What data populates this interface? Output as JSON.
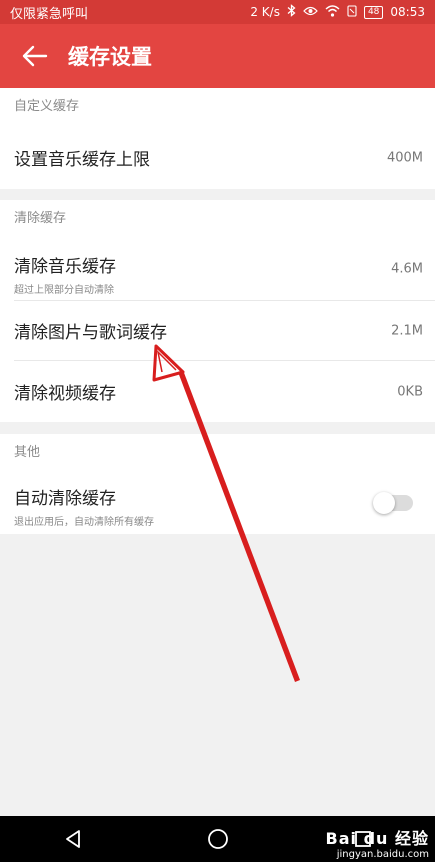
{
  "statusbar": {
    "carrier": "仅限紧急呼叫",
    "net_speed": "2 K/s",
    "battery": "48",
    "time": "08:53"
  },
  "appbar": {
    "title": "缓存设置",
    "back_icon": "arrow-left-icon"
  },
  "custom_section": {
    "header": "自定义缓存",
    "items": [
      {
        "title": "设置音乐缓存上限",
        "value": "400M"
      }
    ]
  },
  "clear_section": {
    "header": "清除缓存",
    "items": [
      {
        "title": "清除音乐缓存",
        "subtitle": "超过上限部分自动清除",
        "value": "4.6M"
      },
      {
        "title": "清除图片与歌词缓存",
        "value": "2.1M"
      },
      {
        "title": "清除视频缓存",
        "value": "0KB"
      }
    ]
  },
  "other_section": {
    "header": "其他",
    "items": [
      {
        "title": "自动清除缓存",
        "subtitle": "退出应用后，自动清除所有缓存",
        "toggle_on": false
      }
    ]
  },
  "watermark": {
    "brand": "Bai du 经验",
    "site": "jingyan.baidu.com"
  },
  "colors": {
    "status_bar": "#d33a36",
    "app_bar": "#e34541",
    "annotation_arrow": "#d81e1e"
  }
}
